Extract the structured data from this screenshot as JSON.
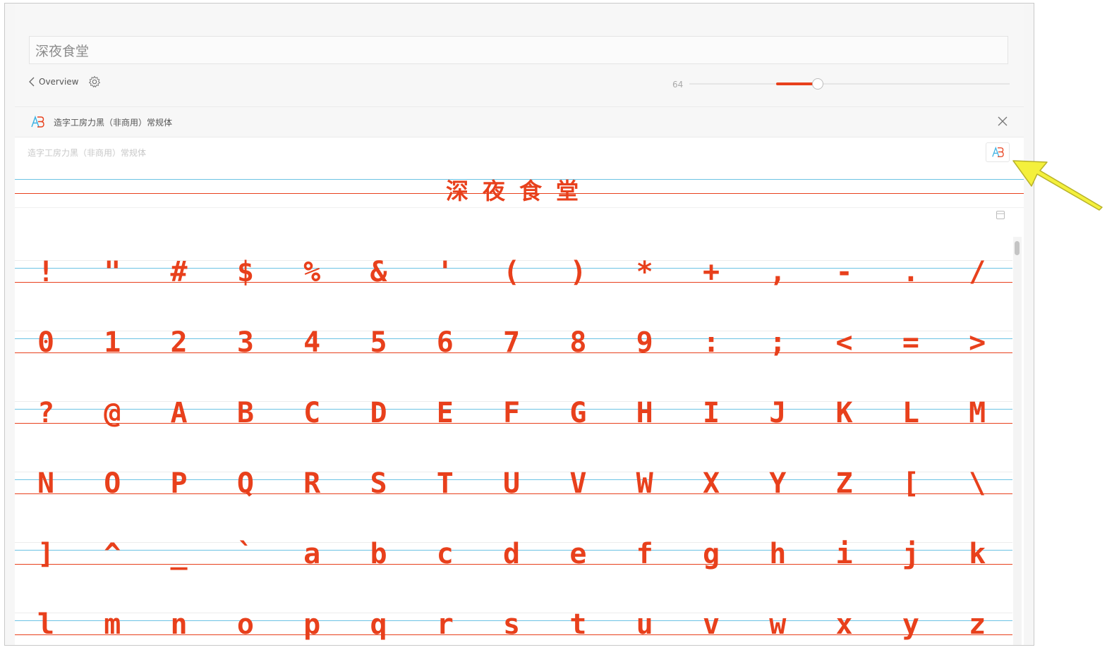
{
  "input": {
    "value": "深夜食堂"
  },
  "toolbar": {
    "back_label": "Overview",
    "size_value": "64",
    "slider_fraction": 0.4,
    "slider_fill_start": 0.27
  },
  "font": {
    "name": "造字工房力黑（非商用）常规体",
    "sub_name": "造字工房力黑（非商用）常规体",
    "sample_text": "深夜食堂"
  },
  "icons": {
    "back": "chevron-left-icon",
    "settings": "gear-icon",
    "font_logo": "font-ab-icon",
    "close": "close-icon",
    "compare": "font-ab-icon",
    "save": "save-icon"
  },
  "colors": {
    "accent": "#e8401c",
    "baseline_blue": "#6cc3e4",
    "arrow": "#f4f03c"
  },
  "glyph_rows": [
    [
      "!",
      "\"",
      "#",
      "$",
      "%",
      "&",
      "'",
      "(",
      ")",
      "*",
      "+",
      ",",
      "-",
      ".",
      "/"
    ],
    [
      "0",
      "1",
      "2",
      "3",
      "4",
      "5",
      "6",
      "7",
      "8",
      "9",
      ":",
      ";",
      "<",
      "=",
      ">"
    ],
    [
      "?",
      "@",
      "A",
      "B",
      "C",
      "D",
      "E",
      "F",
      "G",
      "H",
      "I",
      "J",
      "K",
      "L",
      "M"
    ],
    [
      "N",
      "O",
      "P",
      "Q",
      "R",
      "S",
      "T",
      "U",
      "V",
      "W",
      "X",
      "Y",
      "Z",
      "[",
      "\\"
    ],
    [
      "]",
      "^",
      "_",
      "`",
      "a",
      "b",
      "c",
      "d",
      "e",
      "f",
      "g",
      "h",
      "i",
      "j",
      "k"
    ],
    [
      "l",
      "m",
      "n",
      "o",
      "p",
      "q",
      "r",
      "s",
      "t",
      "u",
      "v",
      "w",
      "x",
      "y",
      "z"
    ]
  ]
}
